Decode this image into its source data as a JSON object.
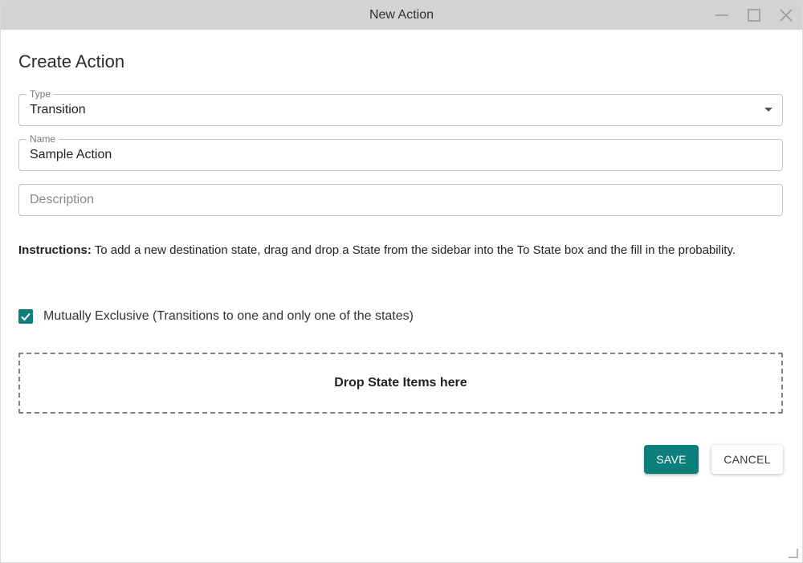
{
  "window": {
    "title": "New Action"
  },
  "dialog": {
    "heading": "Create Action",
    "type_field": {
      "label": "Type",
      "value": "Transition"
    },
    "name_field": {
      "label": "Name",
      "value": "Sample Action"
    },
    "description_field": {
      "placeholder": "Description",
      "value": ""
    },
    "instructions": {
      "prefix": "Instructions:",
      "text": " To add a new destination state, drag and drop a State from the sidebar into the To State box and the fill in the probability."
    },
    "mutually_exclusive": {
      "checked": true,
      "label": "Mutually Exclusive (Transitions to one and only one of the states)"
    },
    "dropzone": {
      "label": "Drop State Items here"
    },
    "buttons": {
      "save": "SAVE",
      "cancel": "CANCEL"
    }
  },
  "colors": {
    "accent": "#0d7f7a",
    "titlebar": "#d3d3d3"
  },
  "icons": [
    "minimize-icon",
    "maximize-icon",
    "close-icon",
    "dropdown-arrow-icon",
    "checkmark-icon",
    "resize-grip-icon"
  ]
}
